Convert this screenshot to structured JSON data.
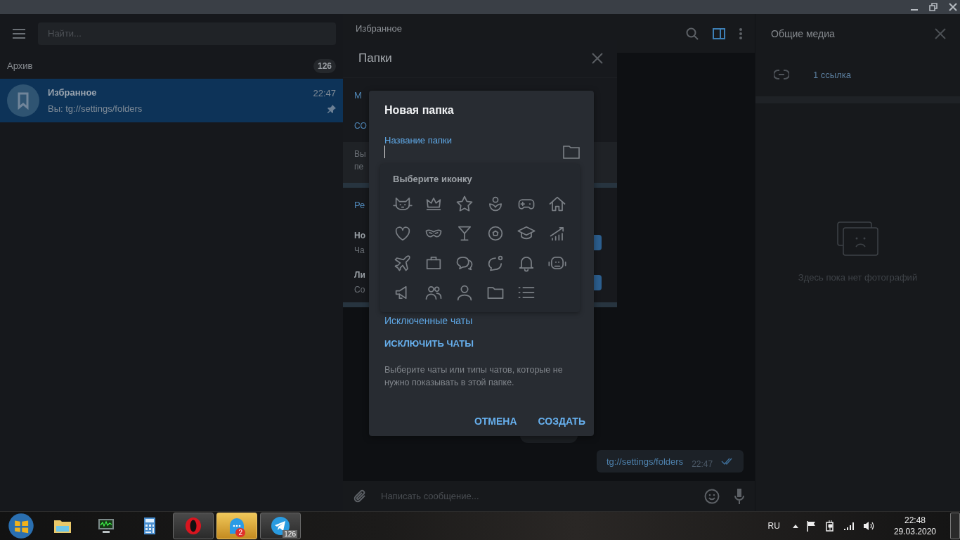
{
  "sidebar": {
    "search": {
      "placeholder": "Найти..."
    },
    "archive": {
      "label": "Архив",
      "count": "126"
    },
    "chats": [
      {
        "name": "Избранное",
        "time": "22:47",
        "preview": "Вы: tg://settings/folders",
        "selected": true,
        "pinned": true
      }
    ]
  },
  "chat": {
    "title": "Избранное",
    "info_toggle": {
      "on": true
    },
    "messages": [
      {
        "text": "tg://settings/folders",
        "time": "22:47",
        "read": true
      }
    ],
    "composer": {
      "placeholder": "Написать сообщение..."
    }
  },
  "folders_panel": {
    "title": "Папки",
    "rows": [
      {
        "kind": "heading",
        "text": "М"
      },
      {
        "kind": "action",
        "text": "СО"
      },
      {
        "kind": "note",
        "lines": [
          "Вы",
          "пе"
        ]
      },
      {
        "kind": "heading",
        "text": "Ре"
      },
      {
        "kind": "folder",
        "name": "Но",
        "info": "Ча"
      },
      {
        "kind": "folder",
        "name": "Ли",
        "info": "Со"
      }
    ]
  },
  "dialog": {
    "title": "Новая папка",
    "name_field": {
      "label": "Название папки",
      "focused": true
    },
    "icon_picker": {
      "title": "Выберите иконку",
      "icons": [
        {
          "kind": "cat"
        },
        {
          "kind": "crown"
        },
        {
          "kind": "star"
        },
        {
          "kind": "flower"
        },
        {
          "kind": "gamepad"
        },
        {
          "kind": "house"
        },
        {
          "kind": "heart"
        },
        {
          "kind": "mask"
        },
        {
          "kind": "cocktail"
        },
        {
          "kind": "ball"
        },
        {
          "kind": "cap"
        },
        {
          "kind": "growth"
        },
        {
          "kind": "airplane"
        },
        {
          "kind": "briefcase"
        },
        {
          "kind": "bubbles"
        },
        {
          "kind": "bubble"
        },
        {
          "kind": "bell"
        },
        {
          "kind": "robot"
        },
        {
          "kind": "megaphone"
        },
        {
          "kind": "people"
        },
        {
          "kind": "person"
        },
        {
          "kind": "folder"
        },
        {
          "kind": "list"
        }
      ]
    },
    "excluded": {
      "heading": "Исключенные чаты",
      "action": "ИСКЛЮЧИТЬ ЧАТЫ",
      "hint": "Выберите чаты или типы чатов, которые не нужно показывать в этой папке."
    },
    "buttons": [
      "ОТМЕНА",
      "СОЗДАТЬ"
    ]
  },
  "media_panel": {
    "title": "Общие медиа",
    "links": "1 ссылка",
    "empty": "Здесь пока нет фотографий"
  },
  "taskbar": {
    "apps": [
      {
        "kind": "start"
      },
      {
        "kind": "explorer",
        "active": false
      },
      {
        "kind": "monitor",
        "active": false
      },
      {
        "kind": "calculator",
        "active": false
      },
      {
        "kind": "opera",
        "active": true
      },
      {
        "kind": "messenger",
        "flashing": true,
        "badge": "2"
      },
      {
        "kind": "telegram",
        "active": true,
        "badge": "126"
      }
    ],
    "language": "RU",
    "time": "22:48",
    "date": "29.03.2020"
  }
}
